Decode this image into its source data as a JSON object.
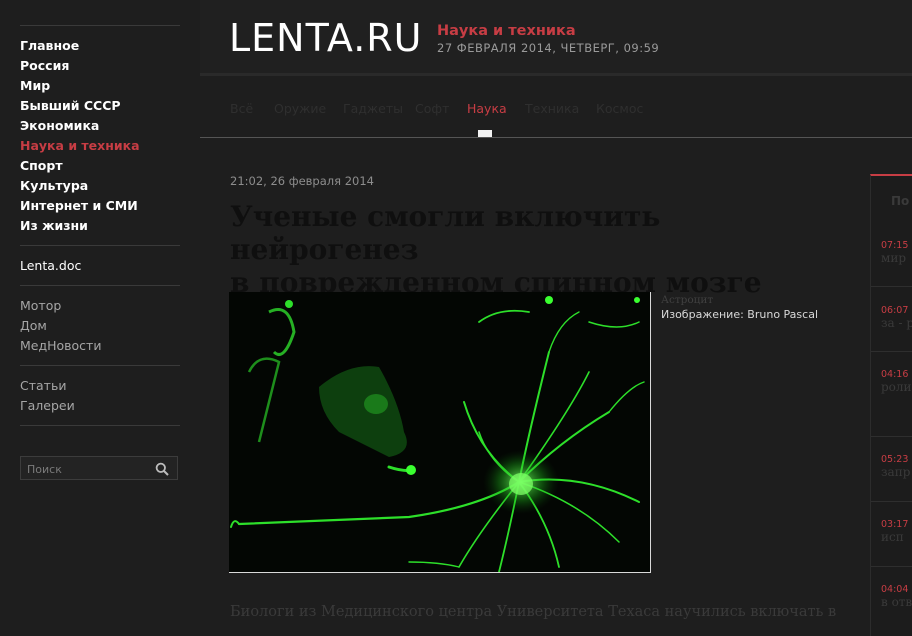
{
  "sidebar": {
    "main_items": [
      {
        "label": "Главное"
      },
      {
        "label": "Россия"
      },
      {
        "label": "Мир"
      },
      {
        "label": "Бывший СССР"
      },
      {
        "label": "Экономика"
      },
      {
        "label": "Наука и техника",
        "active": true
      },
      {
        "label": "Спорт"
      },
      {
        "label": "Культура"
      },
      {
        "label": "Интернет и СМИ"
      },
      {
        "label": "Из жизни"
      }
    ],
    "doc_item": "Lenta.doc",
    "partner_items": [
      "Мотор",
      "Дом",
      "МедНовости"
    ],
    "extra_items": [
      "Статьи",
      "Галереи"
    ],
    "search": {
      "placeholder": "Поиск",
      "icon": "search-icon"
    }
  },
  "header": {
    "logo": "LENTA.RU",
    "section": "Наука и техника",
    "datetime": "27 ФЕВРАЛЯ 2014, ЧЕТВЕРГ, 09:59"
  },
  "subnav": {
    "items": [
      "Всё",
      "Оружие",
      "Гаджеты",
      "Софт",
      "Наука",
      "Техника",
      "Космос"
    ],
    "active": "Наука"
  },
  "article": {
    "timestamp": "21:02, 26 февраля 2014",
    "title_line1": "Ученые смогли включить нейрогенез",
    "title_line2": "в поврежденном спинном мозге",
    "caption": "Астроцит",
    "credit": "Изображение: Bruno Pascal",
    "lead": "Биологи из Медицинского центра Университета Техаса научились включать в"
  },
  "news": {
    "heading": "По",
    "items": [
      {
        "time": "07:15",
        "text": "мир"
      },
      {
        "time": "06:07",
        "text": "за - р"
      },
      {
        "time": "04:16",
        "text": "роли"
      },
      {
        "time": "05:23",
        "text": "запр"
      },
      {
        "time": "03:17",
        "text": "исп"
      },
      {
        "time": "04:04",
        "text": "в отв"
      }
    ]
  },
  "colors": {
    "accent": "#c73d44",
    "background": "#1e1e1e",
    "photo_green": "#2ddf2a"
  }
}
